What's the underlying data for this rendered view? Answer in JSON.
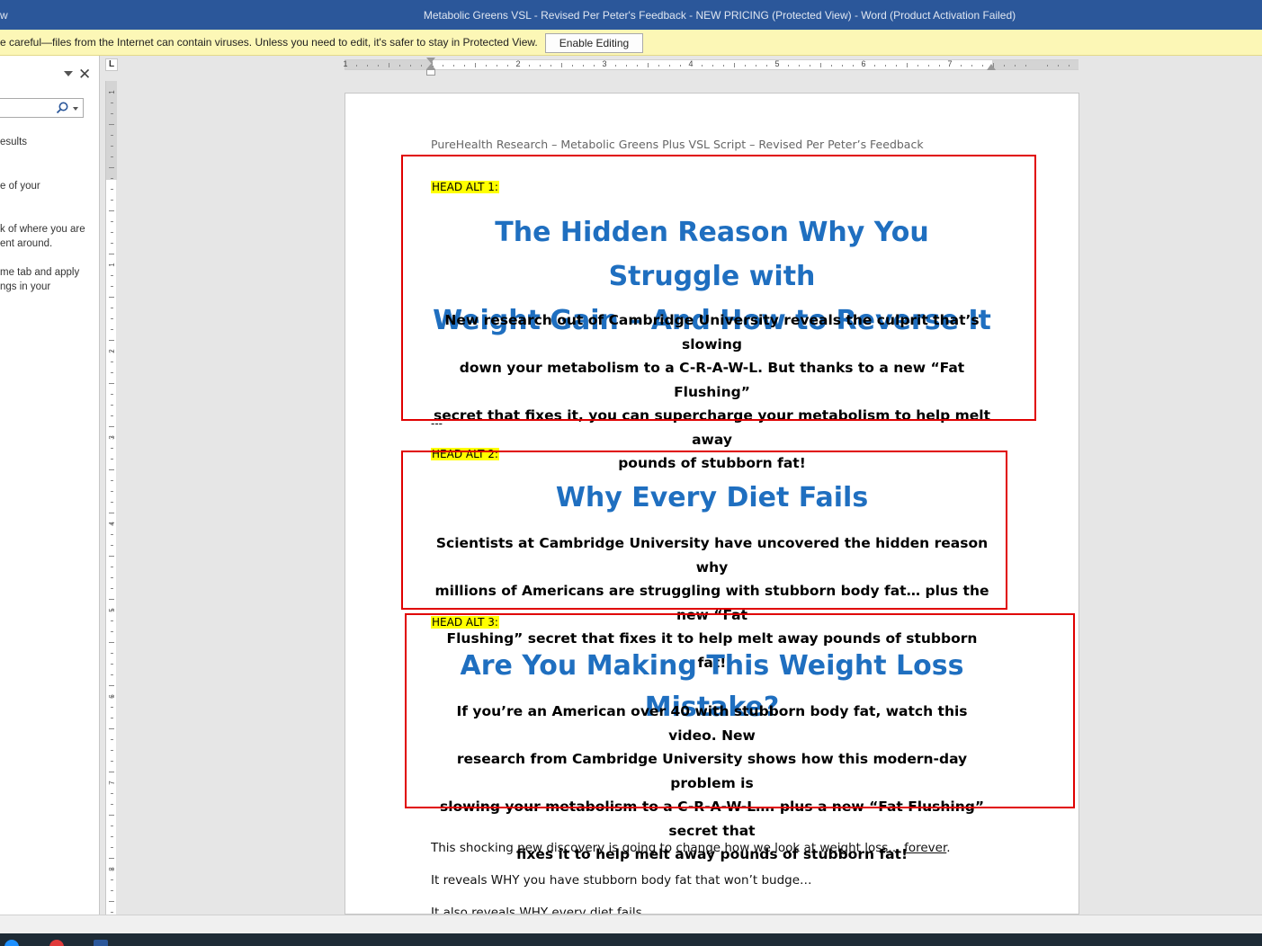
{
  "window": {
    "title_left_fragment": "w",
    "title": "Metabolic Greens VSL - Revised Per Peter's Feedback - NEW PRICING (Protected View) - Word (Product Activation Failed)"
  },
  "protected_view": {
    "message": "e careful—files from the Internet can contain viruses. Unless you need to edit, it's safer to stay in Protected View.",
    "enable_label": "Enable Editing"
  },
  "nav_pane": {
    "lines": [
      "esults",
      "e of your",
      "k of where you are",
      "ent around.",
      "me tab and apply",
      "ngs in your"
    ]
  },
  "ruler": {
    "tab_selector": "L",
    "h_numbers": [
      "1",
      "1",
      "2",
      "3",
      "4",
      "5",
      "6",
      "7"
    ],
    "v_numbers": [
      "1",
      "1",
      "2",
      "3",
      "4",
      "5",
      "6",
      "7",
      "8"
    ]
  },
  "document": {
    "header_text": "PureHealth Research – Metabolic Greens Plus VSL Script – Revised Per Peter’s Feedback",
    "alt1": {
      "label": "HEAD ALT 1:",
      "headline_line1": "The Hidden Reason Why You Struggle with",
      "headline_line2": "Weight Gain – And How to Reverse It",
      "sub_lines": [
        "New research out of Cambridge University reveals the culprit that’s slowing",
        "down your metabolism to a C-R-A-W-L. But thanks to a new “Fat Flushing”",
        "secret that fixes it, you can supercharge your metabolism to help melt away",
        "pounds of stubborn fat!"
      ]
    },
    "separator": "---",
    "alt2": {
      "label": "HEAD ALT 2:",
      "headline": "Why Every Diet Fails",
      "sub_lines": [
        "Scientists at Cambridge University have uncovered the hidden reason why",
        "millions of Americans are struggling with stubborn body fat… plus the new “Fat",
        "Flushing” secret that fixes it to help melt away pounds of stubborn fat!"
      ]
    },
    "alt3": {
      "label": "HEAD ALT 3:",
      "headline": "Are You Making This Weight Loss Mistake?",
      "sub_lines": [
        "If you’re an American over 40 with stubborn body fat, watch this video. New",
        "research from Cambridge University shows how this modern-day problem is",
        "slowing your metabolism to a C-R-A-W-L…. plus a new “Fat Flushing” secret that",
        "fixes it to help melt away pounds of stubborn fat!"
      ]
    },
    "body": {
      "line1_prefix": "This shocking new discovery is going to change how we look at weight loss… ",
      "line1_underlined": "forever",
      "line1_suffix": ".",
      "line2": "It reveals WHY you have stubborn body fat that won’t budge…",
      "line3": "It also reveals WHY every diet fails…"
    }
  },
  "colors": {
    "titlebar": "#2b579a",
    "protected_bar": "#fcf7b6",
    "headline_blue": "#1f6fc0",
    "highlight": "#ffff00",
    "annotation_red": "#e00000"
  }
}
